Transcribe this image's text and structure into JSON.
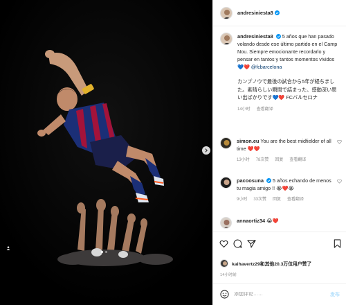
{
  "post": {
    "author": "andresiniesta8",
    "caption_text": "5 años que han pasado volando desde ese último partido en el Camp Nou. Siempre emocionante recordarlo y pensar en tantos y tantos momentos vividos 💙❤️",
    "caption_mention": "@fcbarcelona",
    "caption_jp": "カンプノウで最後の試合から5年が経ちました。素晴らしい瞬間で詰まった、感動深い思い出ばかりです💙❤️ FCバルセロナ",
    "caption_time": "14小时",
    "caption_translate": "查看翻译",
    "liked_by": "kaihavertz29和其他20.3万位用户赞了",
    "posted_ago": "14小时前"
  },
  "comments": [
    {
      "username": "simon.eu",
      "text": "You are the best midfielder of all time ❤️❤️",
      "time": "13小时",
      "likes": "78次赞",
      "reply": "回复",
      "translate": "查看翻译"
    },
    {
      "username": "pacoosuna",
      "text": "5 años echando de menos tu magia amigo !! 😭❤️😭",
      "time": "9小时",
      "likes": "33次赞",
      "reply": "回复",
      "translate": "查看翻译"
    },
    {
      "username": "annaortiz34",
      "text": "😭❤️"
    }
  ],
  "composer": {
    "placeholder": "添加评论……",
    "post_label": "发布"
  },
  "colors": {
    "verified": "#0095f6",
    "mention": "#00376b",
    "post_disabled": "#b2dffc",
    "photo_bg": "#000000"
  },
  "icons": {
    "like": "heart-icon",
    "comment": "comment-icon",
    "share": "share-icon",
    "save": "bookmark-icon",
    "emoji": "emoji-icon",
    "next": "chevron-right-icon",
    "tag": "user-tag-icon"
  },
  "carousel": {
    "current": 1,
    "total": 2
  }
}
